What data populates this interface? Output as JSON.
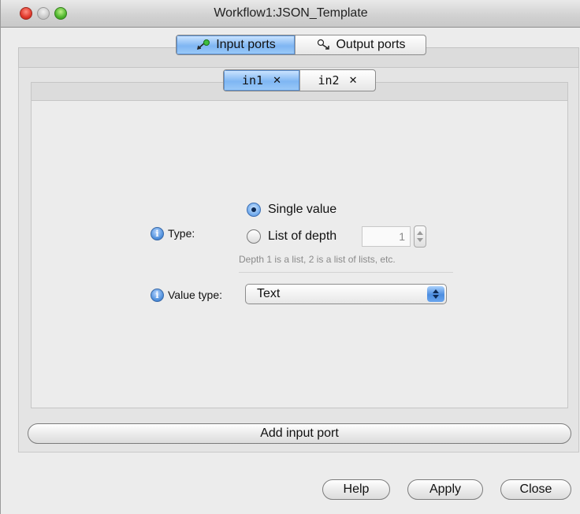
{
  "window": {
    "title": "Workflow1:JSON_Template"
  },
  "port_tabs": [
    {
      "label": "Input ports",
      "icon": "input-port-icon",
      "active": true
    },
    {
      "label": "Output ports",
      "icon": "output-port-icon",
      "active": false
    }
  ],
  "input_tabs": [
    {
      "label": "in1",
      "active": true
    },
    {
      "label": "in2",
      "active": false
    }
  ],
  "type": {
    "label": "Type:",
    "single_value_label": "Single value",
    "list_depth_label": "List of depth",
    "selected": "Single value",
    "depth_value": "1",
    "depth_hint": "Depth 1 is a list, 2 is a list of lists, etc."
  },
  "value_type": {
    "label": "Value type:",
    "selected": "Text"
  },
  "buttons": {
    "add_input_port": "Add input port",
    "help": "Help",
    "apply": "Apply",
    "close": "Close"
  },
  "colors": {
    "active_tab": "#7fb6f3",
    "window_bg": "#ececec",
    "close_traffic": "#e0382b",
    "zoom_traffic": "#4fb62e"
  }
}
